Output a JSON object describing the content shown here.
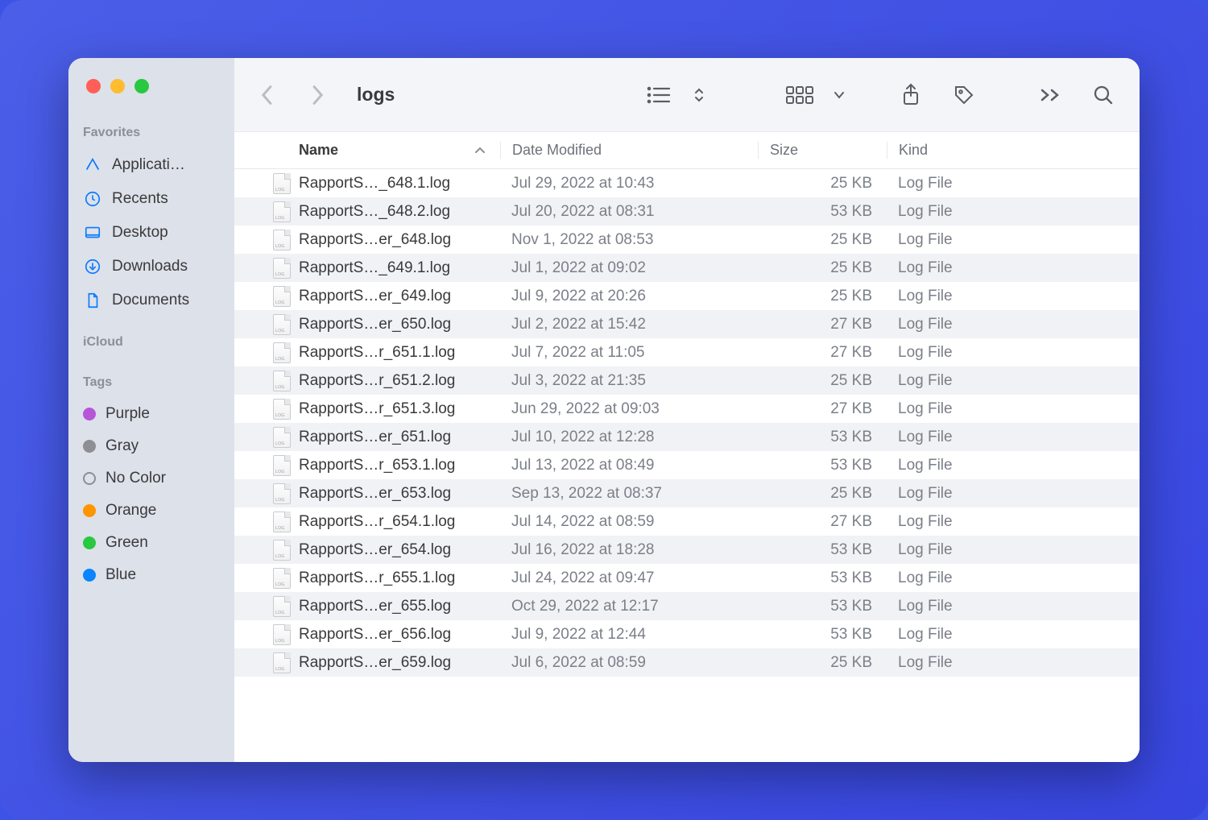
{
  "window": {
    "title": "logs"
  },
  "sidebar": {
    "sections": [
      {
        "label": "Favorites",
        "items": [
          {
            "icon": "applications-icon",
            "label": "Applicati…"
          },
          {
            "icon": "recents-icon",
            "label": "Recents"
          },
          {
            "icon": "desktop-icon",
            "label": "Desktop"
          },
          {
            "icon": "downloads-icon",
            "label": "Downloads"
          },
          {
            "icon": "documents-icon",
            "label": "Documents"
          }
        ]
      },
      {
        "label": "iCloud",
        "items": []
      },
      {
        "label": "Tags",
        "items": [
          {
            "color": "#b657d9",
            "label": "Purple"
          },
          {
            "color": "#8e8e93",
            "label": "Gray"
          },
          {
            "color": "",
            "label": "No Color"
          },
          {
            "color": "#ff9500",
            "label": "Orange"
          },
          {
            "color": "#28c840",
            "label": "Green"
          },
          {
            "color": "#0a84ff",
            "label": "Blue"
          }
        ]
      }
    ]
  },
  "columns": {
    "name": "Name",
    "date": "Date Modified",
    "size": "Size",
    "kind": "Kind"
  },
  "files": [
    {
      "name": "RapportS…_648.1.log",
      "date": "Jul 29, 2022 at 10:43",
      "size": "25 KB",
      "kind": "Log File"
    },
    {
      "name": "RapportS…_648.2.log",
      "date": "Jul 20, 2022 at 08:31",
      "size": "53 KB",
      "kind": "Log File"
    },
    {
      "name": "RapportS…er_648.log",
      "date": "Nov 1, 2022 at 08:53",
      "size": "25 KB",
      "kind": "Log File"
    },
    {
      "name": "RapportS…_649.1.log",
      "date": "Jul 1, 2022 at 09:02",
      "size": "25 KB",
      "kind": "Log File"
    },
    {
      "name": "RapportS…er_649.log",
      "date": "Jul 9, 2022 at 20:26",
      "size": "25 KB",
      "kind": "Log File"
    },
    {
      "name": "RapportS…er_650.log",
      "date": "Jul 2, 2022 at 15:42",
      "size": "27 KB",
      "kind": "Log File"
    },
    {
      "name": "RapportS…r_651.1.log",
      "date": "Jul 7, 2022 at 11:05",
      "size": "27 KB",
      "kind": "Log File"
    },
    {
      "name": "RapportS…r_651.2.log",
      "date": "Jul 3, 2022 at 21:35",
      "size": "25 KB",
      "kind": "Log File"
    },
    {
      "name": "RapportS…r_651.3.log",
      "date": "Jun 29, 2022 at 09:03",
      "size": "27 KB",
      "kind": "Log File"
    },
    {
      "name": "RapportS…er_651.log",
      "date": "Jul 10, 2022 at 12:28",
      "size": "53 KB",
      "kind": "Log File"
    },
    {
      "name": "RapportS…r_653.1.log",
      "date": "Jul 13, 2022 at 08:49",
      "size": "53 KB",
      "kind": "Log File"
    },
    {
      "name": "RapportS…er_653.log",
      "date": "Sep 13, 2022 at 08:37",
      "size": "25 KB",
      "kind": "Log File"
    },
    {
      "name": "RapportS…r_654.1.log",
      "date": "Jul 14, 2022 at 08:59",
      "size": "27 KB",
      "kind": "Log File"
    },
    {
      "name": "RapportS…er_654.log",
      "date": "Jul 16, 2022 at 18:28",
      "size": "53 KB",
      "kind": "Log File"
    },
    {
      "name": "RapportS…r_655.1.log",
      "date": "Jul 24, 2022 at 09:47",
      "size": "53 KB",
      "kind": "Log File"
    },
    {
      "name": "RapportS…er_655.log",
      "date": "Oct 29, 2022 at 12:17",
      "size": "53 KB",
      "kind": "Log File"
    },
    {
      "name": "RapportS…er_656.log",
      "date": "Jul 9, 2022 at 12:44",
      "size": "53 KB",
      "kind": "Log File"
    },
    {
      "name": "RapportS…er_659.log",
      "date": "Jul 6, 2022 at 08:59",
      "size": "25 KB",
      "kind": "Log File"
    }
  ]
}
